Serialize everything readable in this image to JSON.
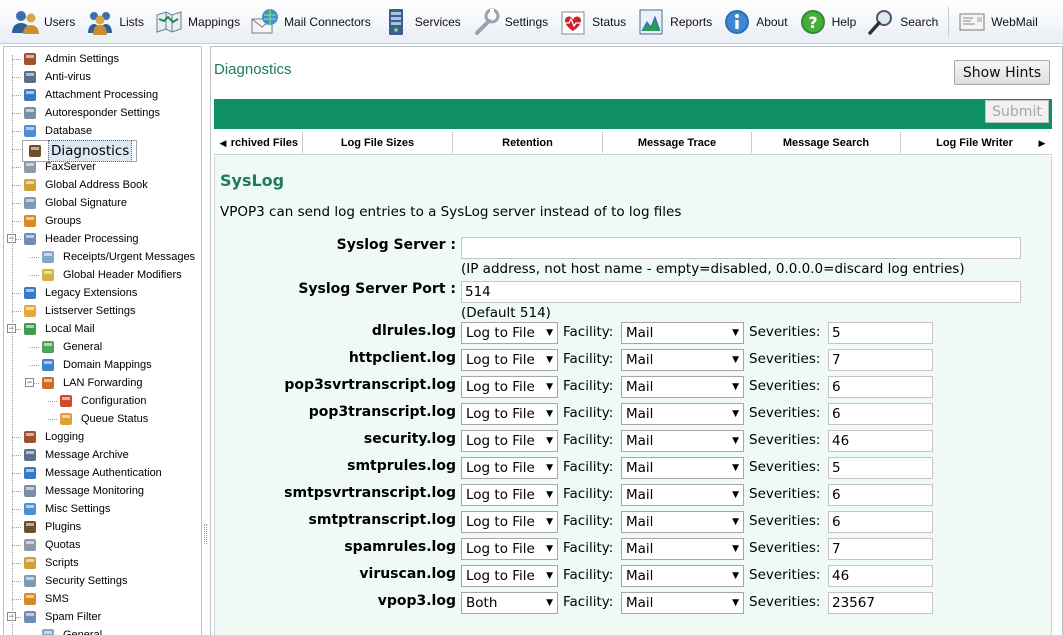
{
  "toolbar": [
    {
      "label": "Users",
      "icon": "users-icon"
    },
    {
      "label": "Lists",
      "icon": "lists-icon"
    },
    {
      "label": "Mappings",
      "icon": "mappings-icon"
    },
    {
      "label": "Mail Connectors",
      "icon": "mail-connectors-icon"
    },
    {
      "label": "Services",
      "icon": "services-icon"
    },
    {
      "label": "Settings",
      "icon": "settings-icon"
    },
    {
      "label": "Status",
      "icon": "status-icon"
    },
    {
      "label": "Reports",
      "icon": "reports-icon"
    },
    {
      "label": "About",
      "icon": "about-icon"
    },
    {
      "label": "Help",
      "icon": "help-icon"
    },
    {
      "label": "Search",
      "icon": "search-icon"
    },
    {
      "label": "WebMail",
      "icon": "webmail-icon"
    }
  ],
  "sidebar": {
    "selected": "Diagnostics",
    "items": [
      {
        "label": "Admin Settings",
        "level": 0
      },
      {
        "label": "Anti-virus",
        "level": 0
      },
      {
        "label": "Attachment Processing",
        "level": 0
      },
      {
        "label": "Autoresponder Settings",
        "level": 0
      },
      {
        "label": "Database",
        "level": 0
      },
      {
        "label": "Diagnostics",
        "level": 0
      },
      {
        "label": "FaxServer",
        "level": 0
      },
      {
        "label": "Global Address Book",
        "level": 0
      },
      {
        "label": "Global Signature",
        "level": 0
      },
      {
        "label": "Groups",
        "level": 0
      },
      {
        "label": "Header Processing",
        "level": 0,
        "expander": "−"
      },
      {
        "label": "Receipts/Urgent Messages",
        "level": 1
      },
      {
        "label": "Global Header Modifiers",
        "level": 1
      },
      {
        "label": "Legacy Extensions",
        "level": 0
      },
      {
        "label": "Listserver Settings",
        "level": 0
      },
      {
        "label": "Local Mail",
        "level": 0,
        "expander": "−"
      },
      {
        "label": "General",
        "level": 1
      },
      {
        "label": "Domain Mappings",
        "level": 1
      },
      {
        "label": "LAN Forwarding",
        "level": 1,
        "expander": "−"
      },
      {
        "label": "Configuration",
        "level": 2
      },
      {
        "label": "Queue Status",
        "level": 2
      },
      {
        "label": "Logging",
        "level": 0
      },
      {
        "label": "Message Archive",
        "level": 0
      },
      {
        "label": "Message Authentication",
        "level": 0
      },
      {
        "label": "Message Monitoring",
        "level": 0
      },
      {
        "label": "Misc Settings",
        "level": 0
      },
      {
        "label": "Plugins",
        "level": 0
      },
      {
        "label": "Quotas",
        "level": 0
      },
      {
        "label": "Scripts",
        "level": 0
      },
      {
        "label": "Security Settings",
        "level": 0
      },
      {
        "label": "SMS",
        "level": 0
      },
      {
        "label": "Spam Filter",
        "level": 0,
        "expander": "−"
      },
      {
        "label": "General",
        "level": 1
      }
    ]
  },
  "page": {
    "title": "Diagnostics",
    "show_hints": "Show Hints",
    "submit": "Submit"
  },
  "tabs": [
    {
      "label": "Archived Files"
    },
    {
      "label": "Log File Sizes"
    },
    {
      "label": "Retention"
    },
    {
      "label": "Message Trace"
    },
    {
      "label": "Message Search"
    },
    {
      "label": "Log File Writer"
    }
  ],
  "syslog": {
    "heading": "SysLog",
    "intro": "VPOP3 can send log entries to a SysLog server instead of to log files",
    "server_label": "Syslog Server :",
    "server_value": "",
    "server_hint": "(IP address, not host name - empty=disabled, 0.0.0.0=discard log entries)",
    "port_label": "Syslog Server Port :",
    "port_value": "514",
    "port_hint": "(Default 514)",
    "facility_label": "Facility:",
    "severities_label": "Severities:",
    "logs": [
      {
        "name": "dlrules.log",
        "destination": "Log to File",
        "facility": "Mail",
        "severities": "5"
      },
      {
        "name": "httpclient.log",
        "destination": "Log to File",
        "facility": "Mail",
        "severities": "7"
      },
      {
        "name": "pop3svrtranscript.log",
        "destination": "Log to File",
        "facility": "Mail",
        "severities": "6"
      },
      {
        "name": "pop3transcript.log",
        "destination": "Log to File",
        "facility": "Mail",
        "severities": "6"
      },
      {
        "name": "security.log",
        "destination": "Log to File",
        "facility": "Mail",
        "severities": "46"
      },
      {
        "name": "smtprules.log",
        "destination": "Log to File",
        "facility": "Mail",
        "severities": "5"
      },
      {
        "name": "smtpsvrtranscript.log",
        "destination": "Log to File",
        "facility": "Mail",
        "severities": "6"
      },
      {
        "name": "smtptranscript.log",
        "destination": "Log to File",
        "facility": "Mail",
        "severities": "6"
      },
      {
        "name": "spamrules.log",
        "destination": "Log to File",
        "facility": "Mail",
        "severities": "7"
      },
      {
        "name": "viruscan.log",
        "destination": "Log to File",
        "facility": "Mail",
        "severities": "46"
      },
      {
        "name": "vpop3.log",
        "destination": "Both",
        "facility": "Mail",
        "severities": "23567"
      }
    ]
  }
}
